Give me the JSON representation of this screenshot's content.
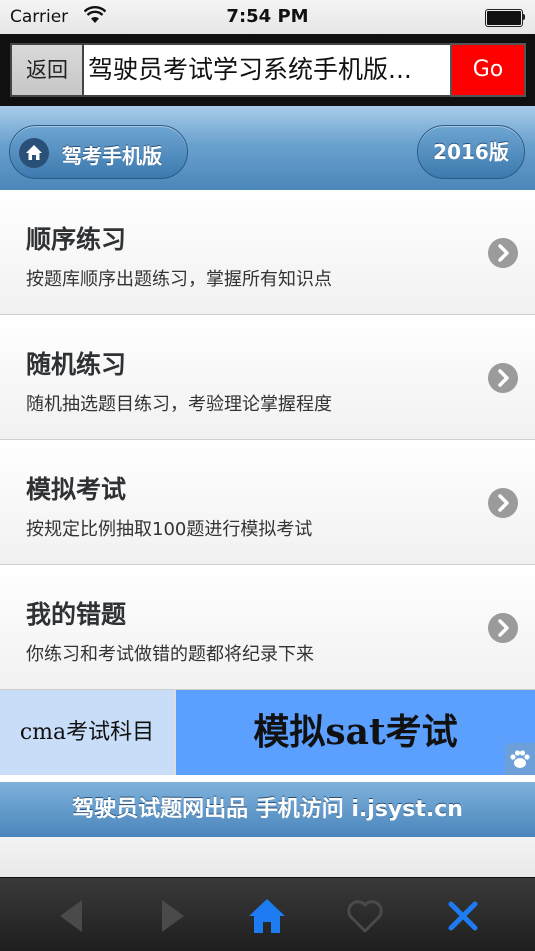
{
  "status_bar": {
    "carrier": "Carrier",
    "time": "7:54 PM"
  },
  "address_bar": {
    "back_label": "返回",
    "url_text": "驾驶员考试学习系统手机版...",
    "go_label": "Go",
    "go_color": "#ff0000"
  },
  "header": {
    "home_label": "驾考手机版",
    "home_icon": "home-icon",
    "version_label": "2016版"
  },
  "menu": {
    "items": [
      {
        "title": "顺序练习",
        "desc": "按题库顺序出题练习，掌握所有知识点"
      },
      {
        "title": "随机练习",
        "desc": "随机抽选题目练习，考验理论掌握程度"
      },
      {
        "title": "模拟考试",
        "desc": "按规定比例抽取100题进行模拟考试"
      },
      {
        "title": "我的错题",
        "desc": "你练习和考试做错的题都将纪录下来"
      }
    ]
  },
  "ad": {
    "left_text": "cma考试科目",
    "right_text": "模拟sat考试",
    "paw_icon": "paw-icon"
  },
  "footer": {
    "banner_text": "驾驶员试题网出品 手机访问 i.jsyst.cn"
  },
  "toolbar": {
    "icons": [
      "back-arrow-icon",
      "forward-arrow-icon",
      "home-icon",
      "heart-icon",
      "close-icon"
    ],
    "active_color": "#1e7cf2"
  }
}
